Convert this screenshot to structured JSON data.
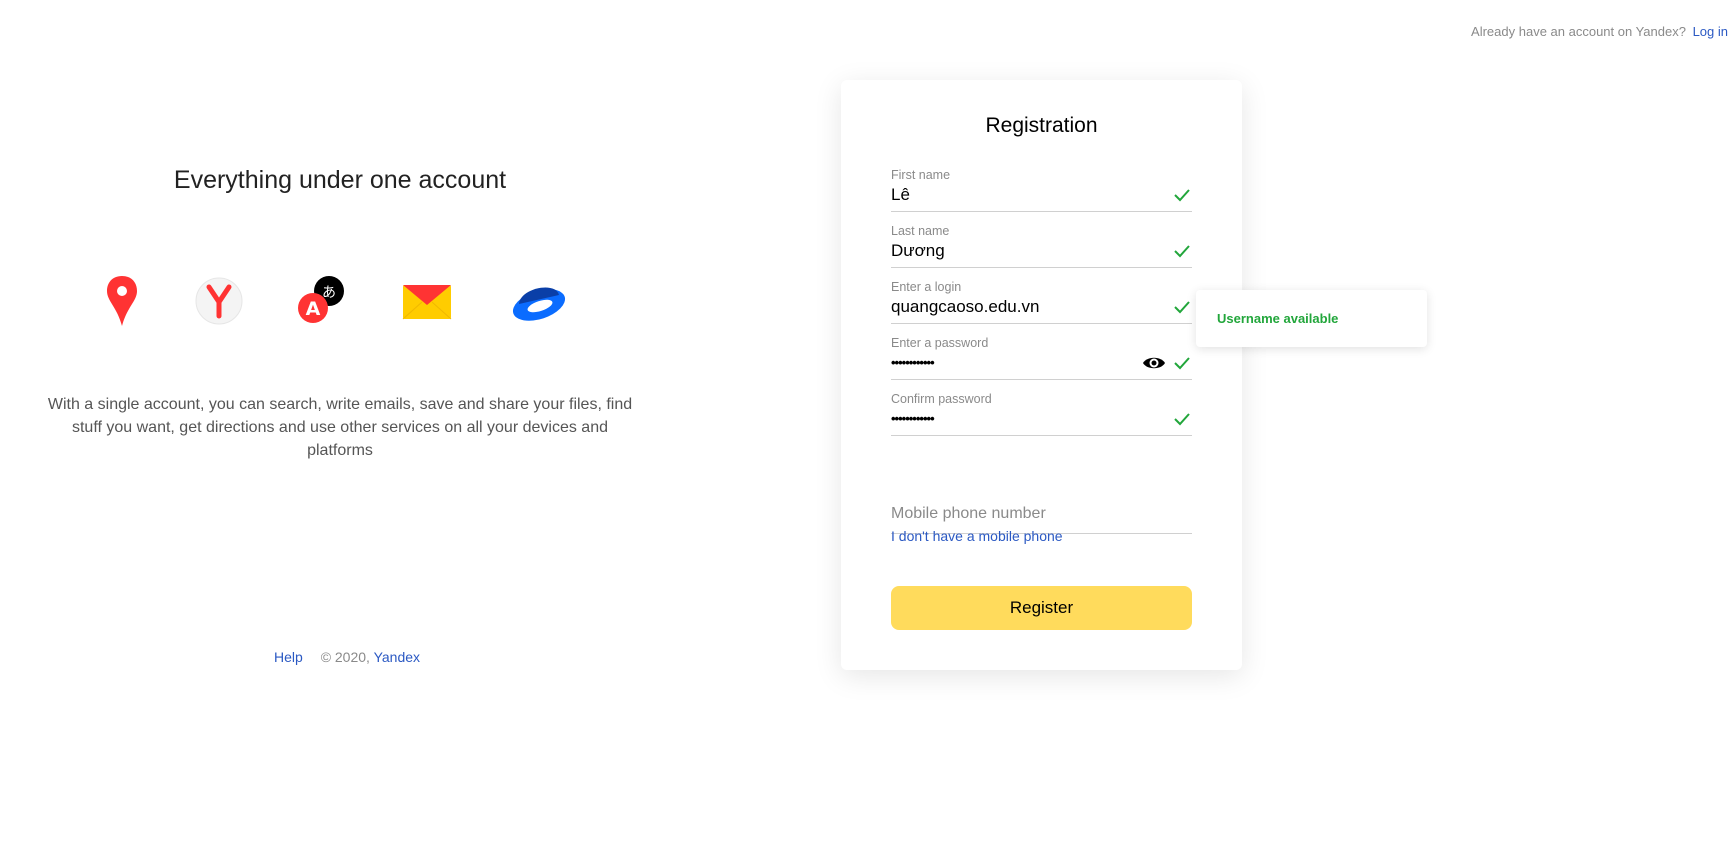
{
  "header": {
    "already_text": "Already have an account on Yandex?",
    "login_link": "Log in"
  },
  "promo": {
    "title": "Everything under one account",
    "description": "With a single account, you can search, write emails, save and share your files, find stuff you want, get directions and use other services on all your devices and platforms",
    "services": [
      "maps-icon",
      "browser-icon",
      "translate-icon",
      "mail-icon",
      "disk-icon"
    ]
  },
  "footer": {
    "help": "Help",
    "copyright": "© 2020,",
    "brand": "Yandex"
  },
  "form": {
    "title": "Registration",
    "first_name": {
      "label": "First name",
      "value": "Lê"
    },
    "last_name": {
      "label": "Last name",
      "value": "Dương"
    },
    "login": {
      "label": "Enter a login",
      "value": "quangcaoso.edu.vn"
    },
    "password": {
      "label": "Enter a password",
      "value": "••••••••••••"
    },
    "confirm": {
      "label": "Confirm password",
      "value": "••••••••••••"
    },
    "phone": {
      "placeholder": "Mobile phone number"
    },
    "no_phone_link": "I don't have a mobile phone",
    "register_button": "Register"
  },
  "tooltip": {
    "text": "Username available"
  },
  "colors": {
    "accent": "#ffdb5c",
    "link": "#2b59c3",
    "success": "#22a63b"
  }
}
